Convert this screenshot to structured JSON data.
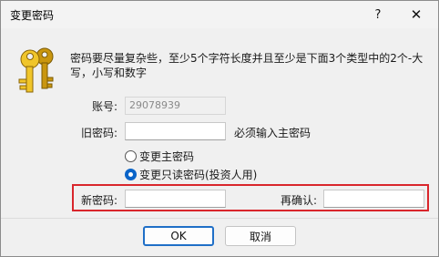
{
  "window": {
    "title": "变更密码",
    "help_label": "?",
    "close_label": "✕"
  },
  "icon": {
    "name": "keys-icon",
    "color": "#e0b21a"
  },
  "description": "密码要尽量复杂些，至少5个字符长度并且至少是下面3个类型中的2个-大写，小写和数字",
  "fields": {
    "account_label": "账号:",
    "account_value": "29078939",
    "old_password_label": "旧密码:",
    "old_password_value": "",
    "old_password_hint": "必须输入主密码",
    "new_password_label": "新密码:",
    "new_password_value": "",
    "confirm_label": "再确认:",
    "confirm_value": ""
  },
  "radio": {
    "options": [
      {
        "label": "变更主密码",
        "checked": false
      },
      {
        "label": "变更只读密码(投资人用)",
        "checked": true
      }
    ]
  },
  "buttons": {
    "ok_label": "OK",
    "cancel_label": "取消"
  },
  "colors": {
    "highlight": "#d9262c",
    "accent": "#0a64c8"
  }
}
